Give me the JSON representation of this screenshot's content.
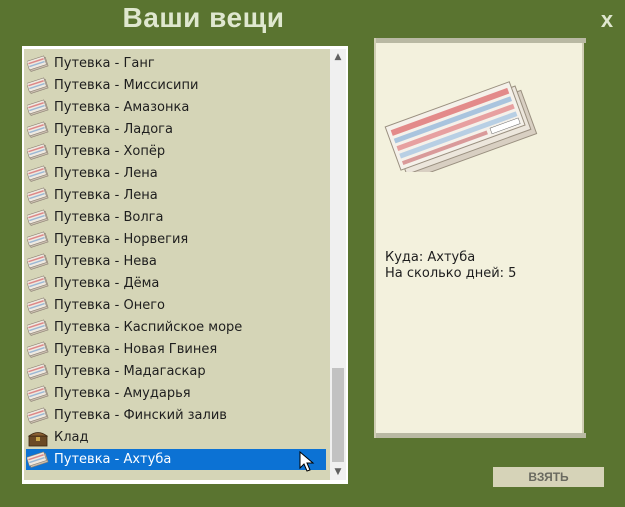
{
  "window": {
    "title": "Ваши вещи",
    "close_label": "x"
  },
  "items": [
    {
      "label": "Путевка - Ганг",
      "icon": "ticket-icon"
    },
    {
      "label": "Путевка - Миссисипи",
      "icon": "ticket-icon"
    },
    {
      "label": "Путевка - Амазонка",
      "icon": "ticket-icon"
    },
    {
      "label": "Путевка - Ладога",
      "icon": "ticket-icon"
    },
    {
      "label": "Путевка - Хопёр",
      "icon": "ticket-icon"
    },
    {
      "label": "Путевка - Лена",
      "icon": "ticket-icon"
    },
    {
      "label": "Путевка - Лена",
      "icon": "ticket-icon"
    },
    {
      "label": "Путевка - Волга",
      "icon": "ticket-icon"
    },
    {
      "label": "Путевка - Норвегия",
      "icon": "ticket-icon"
    },
    {
      "label": "Путевка - Нева",
      "icon": "ticket-icon"
    },
    {
      "label": "Путевка - Дёма",
      "icon": "ticket-icon"
    },
    {
      "label": "Путевка - Онего",
      "icon": "ticket-icon"
    },
    {
      "label": "Путевка - Каспийское море",
      "icon": "ticket-icon"
    },
    {
      "label": "Путевка - Новая Гвинея",
      "icon": "ticket-icon"
    },
    {
      "label": "Путевка - Мадагаскар",
      "icon": "ticket-icon"
    },
    {
      "label": "Путевка - Амударья",
      "icon": "ticket-icon"
    },
    {
      "label": "Путевка - Финский залив",
      "icon": "ticket-icon"
    },
    {
      "label": "Клад",
      "icon": "treasure-chest-icon"
    },
    {
      "label": "Путевка - Ахтуба",
      "icon": "ticket-icon",
      "selected": true
    }
  ],
  "detail": {
    "image_icon": "ticket-bundle-icon",
    "destination_line": "Куда: Ахтуба",
    "days_line": "На сколько дней: 5"
  },
  "actions": {
    "take_label": "ВЗЯТЬ"
  },
  "colors": {
    "background": "#5a7430",
    "list_background": "#d5d5b7",
    "selection": "#0c72d4",
    "detail_background": "#f3f1dd",
    "title_text": "#dfe7cf"
  }
}
